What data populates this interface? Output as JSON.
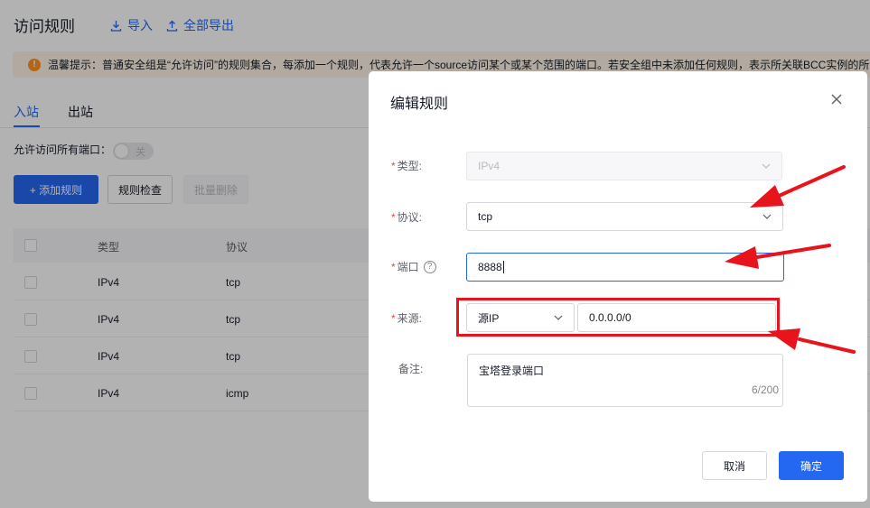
{
  "header": {
    "title": "访问规则",
    "import_label": "导入",
    "export_label": "全部导出"
  },
  "notice": {
    "text": "温馨提示：普通安全组是“允许访问”的规则集合，每添加一个规则，代表允许一个source访问某个或某个范围的端口。若安全组中未添加任何规则，表示所关联BCC实例的所"
  },
  "tabs": [
    {
      "label": "入站"
    },
    {
      "label": "出站"
    }
  ],
  "allow_all_ports": {
    "label": "允许访问所有端口：",
    "toggle_text": "关"
  },
  "toolbar": {
    "add_label": "+ 添加规则",
    "check_label": "规则检查",
    "batch_delete_label": "批量删除"
  },
  "table": {
    "headers": [
      "类型",
      "协议"
    ],
    "rows": [
      {
        "type": "IPv4",
        "protocol": "tcp"
      },
      {
        "type": "IPv4",
        "protocol": "tcp"
      },
      {
        "type": "IPv4",
        "protocol": "tcp"
      },
      {
        "type": "IPv4",
        "protocol": "icmp"
      }
    ]
  },
  "dialog": {
    "title": "编辑规则",
    "type": {
      "label": "类型:",
      "value": "IPv4"
    },
    "protocol": {
      "label": "协议:",
      "value": "tcp"
    },
    "port": {
      "label": "端口",
      "value": "8888",
      "help": "?"
    },
    "source": {
      "label": "来源:",
      "kind": "源IP",
      "value": "0.0.0.0/0"
    },
    "remark": {
      "label": "备注:",
      "value": "宝塔登录端口",
      "counter": "6/200"
    },
    "cancel_label": "取消",
    "confirm_label": "确定",
    "required_mark": "*"
  },
  "colors": {
    "primary": "#2468f2",
    "annotation_red": "#e8141b",
    "required": "#f33e3e",
    "notice_bg": "#fff4e6"
  },
  "icons": {
    "import": "download-icon",
    "export": "upload-icon",
    "warning": "warning-icon",
    "close": "close-icon",
    "chevron": "chevron-down-icon"
  }
}
